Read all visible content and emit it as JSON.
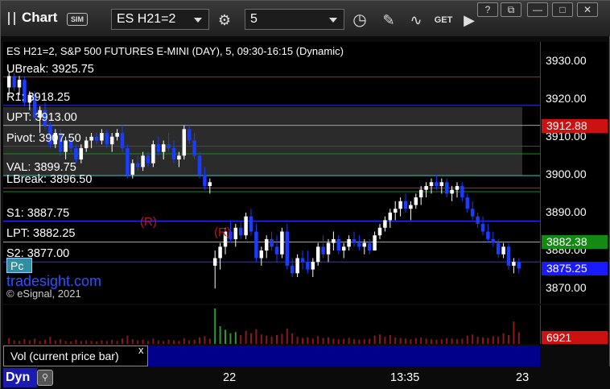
{
  "toolbar": {
    "app_name": "Chart",
    "sim_badge": "SIM",
    "symbol": "ES H21=2",
    "interval": "5",
    "get_label": "GET",
    "window_buttons": [
      "?",
      "⧉",
      "—",
      "□",
      "✕"
    ]
  },
  "chart": {
    "title": "ES H21=2, S&P 500 FUTURES E-MINI (DAY), 5, 09:30-16:15 (Dynamic)",
    "levels": [
      {
        "label": "UBreak: 3925.75",
        "value": 3925.75,
        "color": "#d2172d"
      },
      {
        "label": "R1: 3918.25",
        "value": 3918.25,
        "color": "#3030ff"
      },
      {
        "label": "UPT: 3913.00",
        "value": 3913.0,
        "color": "#a0a0a0"
      },
      {
        "label": "Pivot: 3907.50",
        "value": 3907.5,
        "color": "#3030ff"
      },
      {
        "label": "VAL: 3899.75",
        "value": 3899.75,
        "color": "#2dd0c8"
      },
      {
        "label": "LBreak: 3896.50",
        "value": 3896.5,
        "color": "#d2172d"
      },
      {
        "label": "S1: 3887.75",
        "value": 3887.75,
        "color": "#3030ff"
      },
      {
        "label": "LPT: 3882.25",
        "value": 3882.25,
        "color": "#a0a0a0"
      },
      {
        "label": "S2: 3877.00",
        "value": 3877.0,
        "color": "#3030ff"
      }
    ],
    "extra_lines": [
      {
        "value": 3905.5,
        "color": "#1b8a1b"
      },
      {
        "value": 3895.5,
        "color": "#1b8a1b"
      }
    ],
    "value_area": {
      "high": 3917.8,
      "low": 3899.75
    },
    "ylim": [
      3866,
      3935
    ],
    "price_ticks": [
      "3930.00",
      "3920.00",
      "3910.00",
      "3900.00",
      "3890.00",
      "3880.00",
      "3870.00"
    ],
    "price_tick_values": [
      3930,
      3920,
      3910,
      3900,
      3890,
      3880,
      3870
    ],
    "tags": [
      {
        "text": "3912.88",
        "value": 3912.88,
        "bg": "#cc1111"
      },
      {
        "text": "3882.38",
        "value": 3882.38,
        "bg": "#138a13"
      },
      {
        "text": "3875.25",
        "value": 3875.25,
        "bg": "#1a1aff"
      }
    ],
    "r_markers": [
      "(R)",
      "(R)"
    ],
    "branding": "tradesight.com",
    "copyright": "© eSignal, 2021",
    "pc_label": "Pc"
  },
  "chart_data": {
    "type": "candlestick",
    "candles": [
      [
        3923,
        3927,
        3921,
        3926
      ],
      [
        3926,
        3927,
        3922,
        3923
      ],
      [
        3923,
        3926,
        3921,
        3925
      ],
      [
        3925,
        3926,
        3918,
        3919
      ],
      [
        3919,
        3922,
        3917,
        3921
      ],
      [
        3921,
        3922,
        3914,
        3915
      ],
      [
        3915,
        3918,
        3911,
        3917
      ],
      [
        3917,
        3919,
        3912,
        3913
      ],
      [
        3913,
        3914,
        3907,
        3908
      ],
      [
        3908,
        3912,
        3907,
        3911
      ],
      [
        3911,
        3912,
        3905,
        3906
      ],
      [
        3906,
        3910,
        3904,
        3909
      ],
      [
        3909,
        3910,
        3906,
        3907
      ],
      [
        3907,
        3908,
        3903,
        3904
      ],
      [
        3904,
        3908,
        3903,
        3907
      ],
      [
        3907,
        3910,
        3906,
        3909
      ],
      [
        3909,
        3911,
        3907,
        3910
      ],
      [
        3910,
        3911,
        3908,
        3909
      ],
      [
        3909,
        3912,
        3908,
        3911
      ],
      [
        3911,
        3912,
        3907,
        3908
      ],
      [
        3908,
        3911,
        3906,
        3910
      ],
      [
        3910,
        3912,
        3909,
        3911
      ],
      [
        3911,
        3913,
        3906,
        3907
      ],
      [
        3907,
        3908,
        3899,
        3900
      ],
      [
        3900,
        3904,
        3899,
        3903
      ],
      [
        3903,
        3905,
        3901,
        3902
      ],
      [
        3902,
        3906,
        3901,
        3905
      ],
      [
        3905,
        3906,
        3902,
        3903
      ],
      [
        3903,
        3909,
        3902,
        3908
      ],
      [
        3908,
        3910,
        3905,
        3906
      ],
      [
        3906,
        3909,
        3904,
        3908
      ],
      [
        3908,
        3911,
        3906,
        3907
      ],
      [
        3907,
        3909,
        3903,
        3904
      ],
      [
        3904,
        3906,
        3902,
        3905
      ],
      [
        3905,
        3913,
        3904,
        3912
      ],
      [
        3912,
        3913,
        3908,
        3909
      ],
      [
        3909,
        3911,
        3904,
        3905
      ],
      [
        3905,
        3906,
        3899,
        3900
      ],
      [
        3900,
        3902,
        3896,
        3897
      ],
      [
        3897,
        3899,
        3895,
        3898
      ],
      [
        3876,
        3880,
        3870,
        3878
      ],
      [
        3878,
        3882,
        3875,
        3881
      ],
      [
        3881,
        3886,
        3879,
        3885
      ],
      [
        3885,
        3888,
        3882,
        3883
      ],
      [
        3883,
        3887,
        3881,
        3886
      ],
      [
        3886,
        3888,
        3883,
        3884
      ],
      [
        3884,
        3890,
        3883,
        3889
      ],
      [
        3889,
        3891,
        3884,
        3885
      ],
      [
        3885,
        3887,
        3877,
        3878
      ],
      [
        3878,
        3881,
        3876,
        3880
      ],
      [
        3880,
        3884,
        3878,
        3883
      ],
      [
        3883,
        3885,
        3880,
        3881
      ],
      [
        3881,
        3884,
        3877,
        3879
      ],
      [
        3879,
        3886,
        3878,
        3885
      ],
      [
        3885,
        3887,
        3875,
        3876
      ],
      [
        3876,
        3878,
        3873,
        3874
      ],
      [
        3874,
        3879,
        3873,
        3878
      ],
      [
        3878,
        3880,
        3875,
        3877
      ],
      [
        3877,
        3880,
        3874,
        3875
      ],
      [
        3875,
        3878,
        3873,
        3877
      ],
      [
        3877,
        3882,
        3876,
        3881
      ],
      [
        3881,
        3884,
        3878,
        3879
      ],
      [
        3879,
        3883,
        3877,
        3882
      ],
      [
        3882,
        3885,
        3880,
        3883
      ],
      [
        3883,
        3884,
        3879,
        3880
      ],
      [
        3880,
        3882,
        3878,
        3881
      ],
      [
        3881,
        3884,
        3880,
        3883
      ],
      [
        3883,
        3885,
        3881,
        3882
      ],
      [
        3882,
        3884,
        3880,
        3881
      ],
      [
        3881,
        3883,
        3879,
        3882
      ],
      [
        3882,
        3883,
        3879,
        3880
      ],
      [
        3880,
        3885,
        3880,
        3884
      ],
      [
        3884,
        3887,
        3883,
        3886
      ],
      [
        3886,
        3889,
        3885,
        3888
      ],
      [
        3888,
        3891,
        3886,
        3890
      ],
      [
        3890,
        3893,
        3888,
        3891
      ],
      [
        3891,
        3894,
        3889,
        3893
      ],
      [
        3893,
        3895,
        3890,
        3891
      ],
      [
        3891,
        3893,
        3888,
        3892
      ],
      [
        3892,
        3895,
        3891,
        3894
      ],
      [
        3894,
        3897,
        3892,
        3896
      ],
      [
        3896,
        3898,
        3894,
        3897
      ],
      [
        3897,
        3899,
        3895,
        3898
      ],
      [
        3898,
        3900,
        3896,
        3897
      ],
      [
        3897,
        3899,
        3895,
        3898
      ],
      [
        3898,
        3899,
        3894,
        3895
      ],
      [
        3895,
        3897,
        3893,
        3896
      ],
      [
        3896,
        3898,
        3894,
        3897
      ],
      [
        3897,
        3898,
        3893,
        3894
      ],
      [
        3894,
        3895,
        3890,
        3891
      ],
      [
        3891,
        3893,
        3888,
        3889
      ],
      [
        3889,
        3890,
        3886,
        3887
      ],
      [
        3887,
        3889,
        3884,
        3885
      ],
      [
        3885,
        3887,
        3882,
        3883
      ],
      [
        3883,
        3885,
        3881,
        3882
      ],
      [
        3882,
        3883,
        3878,
        3879
      ],
      [
        3879,
        3882,
        3878,
        3881
      ],
      [
        3881,
        3882,
        3875,
        3876
      ],
      [
        3876,
        3878,
        3874,
        3877
      ],
      [
        3877,
        3878,
        3874,
        3875.25
      ]
    ],
    "volume": [
      10,
      6,
      5,
      8,
      6,
      9,
      5,
      7,
      12,
      6,
      8,
      5,
      4,
      7,
      5,
      6,
      5,
      4,
      6,
      5,
      7,
      5,
      9,
      14,
      8,
      6,
      7,
      5,
      9,
      6,
      5,
      7,
      6,
      5,
      10,
      6,
      7,
      11,
      13,
      9,
      60,
      30,
      24,
      18,
      20,
      15,
      22,
      18,
      25,
      16,
      14,
      12,
      15,
      17,
      26,
      18,
      12,
      10,
      11,
      9,
      13,
      10,
      11,
      9,
      8,
      9,
      10,
      8,
      7,
      8,
      9,
      14,
      16,
      12,
      15,
      11,
      10,
      9,
      8,
      10,
      11,
      9,
      8,
      7,
      8,
      10,
      9,
      8,
      9,
      14,
      16,
      12,
      11,
      10,
      13,
      12,
      18,
      15,
      38,
      20
    ],
    "ylim": [
      3866,
      3935
    ],
    "volume_label": "6921",
    "volume_tag_bg": "#cc1111",
    "dates": [
      "22",
      "13:35",
      "23"
    ]
  },
  "vol_panel": {
    "label": "Vol (current price bar)",
    "close": "x"
  },
  "footer": {
    "label": "Dyn"
  }
}
